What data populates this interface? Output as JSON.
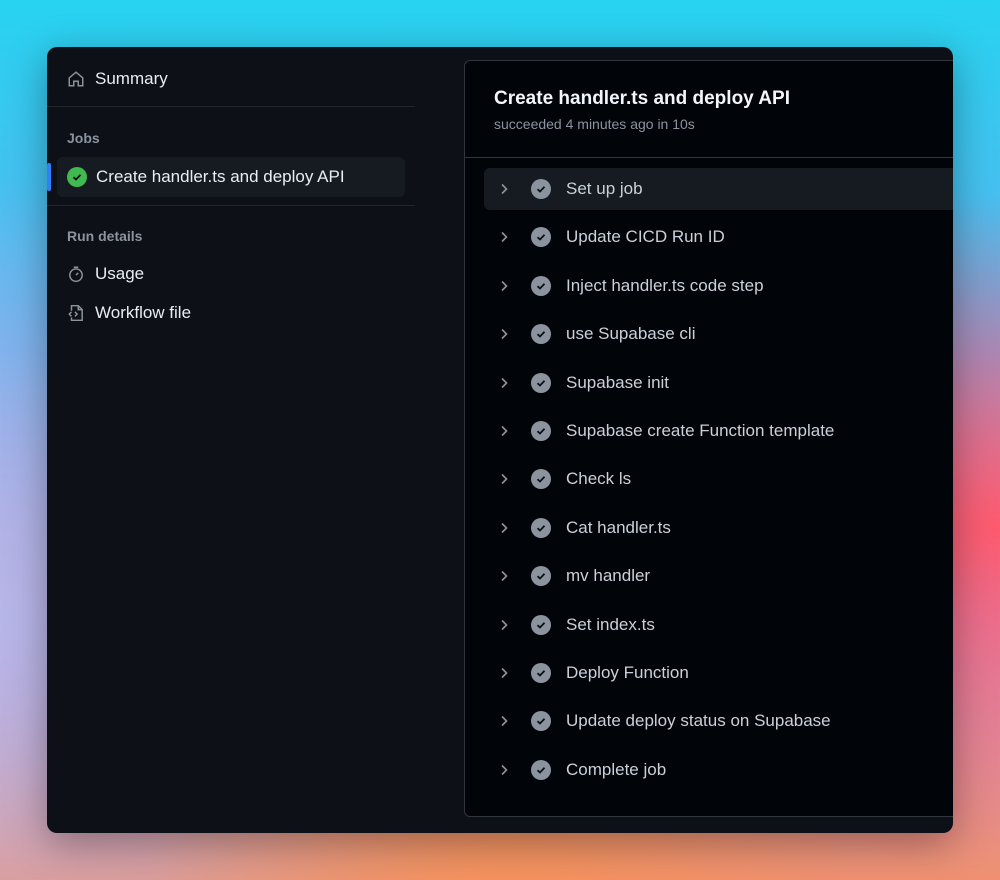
{
  "sidebar": {
    "summary": "Summary",
    "jobs_header": "Jobs",
    "job": "Create handler.ts and deploy API",
    "run_details_header": "Run details",
    "usage": "Usage",
    "workflow_file": "Workflow file"
  },
  "main": {
    "title": "Create handler.ts and deploy API",
    "status": "succeeded 4 minutes ago in 10s",
    "steps": [
      "Set up job",
      "Update CICD Run ID",
      "Inject handler.ts code step",
      "use Supabase cli",
      "Supabase init",
      "Supabase create Function template",
      "Check ls",
      "Cat handler.ts",
      "mv handler",
      "Set index.ts",
      "Deploy Function",
      "Update deploy status on Supabase",
      "Complete job"
    ]
  },
  "colors": {
    "success": "#3fb950",
    "accent": "#2f81f7"
  }
}
